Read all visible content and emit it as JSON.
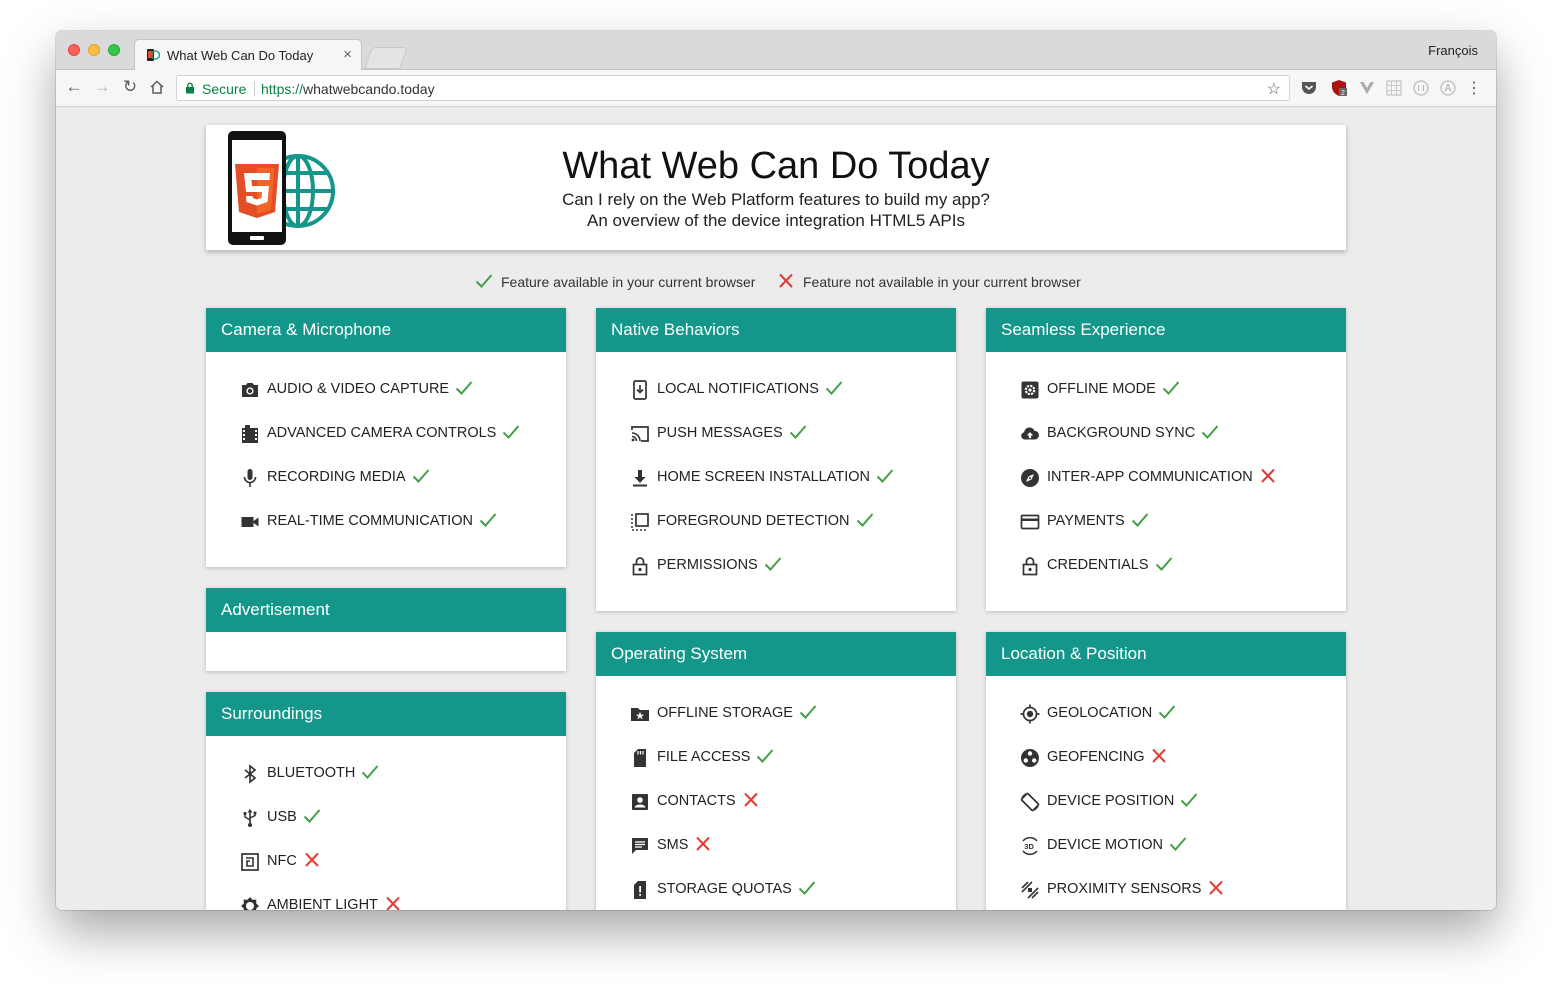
{
  "browser": {
    "tab_title": "What Web Can Do Today",
    "tab_close": "×",
    "profile_name": "François",
    "secure_label": "Secure",
    "url_scheme": "https://",
    "url_host": "whatwebcando.today"
  },
  "header": {
    "title": "What Web Can Do Today",
    "subtitle_line1": "Can I rely on the Web Platform features to build my app?",
    "subtitle_line2": "An overview of the device integration HTML5 APIs"
  },
  "legend": {
    "available": "Feature available in your current browser",
    "unavailable": "Feature not available in your current browser"
  },
  "colors": {
    "accent": "#14978a",
    "available": "#43a047",
    "unavailable": "#e53935"
  },
  "cards": {
    "camera": {
      "title": "Camera & Microphone",
      "features": [
        {
          "label": "AUDIO & VIDEO CAPTURE",
          "icon": "camera-icon",
          "available": true
        },
        {
          "label": "ADVANCED CAMERA CONTROLS",
          "icon": "film-icon",
          "available": true
        },
        {
          "label": "RECORDING MEDIA",
          "icon": "microphone-icon",
          "available": true
        },
        {
          "label": "REAL-TIME COMMUNICATION",
          "icon": "video-camera-icon",
          "available": true
        }
      ]
    },
    "advertisement": {
      "title": "Advertisement"
    },
    "surroundings": {
      "title": "Surroundings",
      "features": [
        {
          "label": "BLUETOOTH",
          "icon": "bluetooth-icon",
          "available": true
        },
        {
          "label": "USB",
          "icon": "usb-icon",
          "available": true
        },
        {
          "label": "NFC",
          "icon": "nfc-icon",
          "available": false
        },
        {
          "label": "AMBIENT LIGHT",
          "icon": "brightness-icon",
          "available": false
        }
      ]
    },
    "native": {
      "title": "Native Behaviors",
      "features": [
        {
          "label": "LOCAL NOTIFICATIONS",
          "icon": "phone-notification-icon",
          "available": true
        },
        {
          "label": "PUSH MESSAGES",
          "icon": "cast-icon",
          "available": true
        },
        {
          "label": "HOME SCREEN INSTALLATION",
          "icon": "download-icon",
          "available": true
        },
        {
          "label": "FOREGROUND DETECTION",
          "icon": "select-window-icon",
          "available": true
        },
        {
          "label": "PERMISSIONS",
          "icon": "lock-open-icon",
          "available": true
        }
      ]
    },
    "os": {
      "title": "Operating System",
      "features": [
        {
          "label": "OFFLINE STORAGE",
          "icon": "folder-star-icon",
          "available": true
        },
        {
          "label": "FILE ACCESS",
          "icon": "sd-card-icon",
          "available": true
        },
        {
          "label": "CONTACTS",
          "icon": "contact-icon",
          "available": false
        },
        {
          "label": "SMS",
          "icon": "message-icon",
          "available": false
        },
        {
          "label": "STORAGE QUOTAS",
          "icon": "sd-alert-icon",
          "available": true
        }
      ]
    },
    "seamless": {
      "title": "Seamless Experience",
      "features": [
        {
          "label": "OFFLINE MODE",
          "icon": "gear-box-icon",
          "available": true
        },
        {
          "label": "BACKGROUND SYNC",
          "icon": "cloud-upload-icon",
          "available": true
        },
        {
          "label": "INTER-APP COMMUNICATION",
          "icon": "compass-icon",
          "available": false
        },
        {
          "label": "PAYMENTS",
          "icon": "credit-card-icon",
          "available": true
        },
        {
          "label": "CREDENTIALS",
          "icon": "lock-icon",
          "available": true
        }
      ]
    },
    "location": {
      "title": "Location & Position",
      "features": [
        {
          "label": "GEOLOCATION",
          "icon": "crosshair-icon",
          "available": true
        },
        {
          "label": "GEOFENCING",
          "icon": "geofence-icon",
          "available": false
        },
        {
          "label": "DEVICE POSITION",
          "icon": "screen-rotation-icon",
          "available": true
        },
        {
          "label": "DEVICE MOTION",
          "icon": "3d-rotation-icon",
          "available": true
        },
        {
          "label": "PROXIMITY SENSORS",
          "icon": "proximity-icon",
          "available": false
        }
      ]
    }
  }
}
